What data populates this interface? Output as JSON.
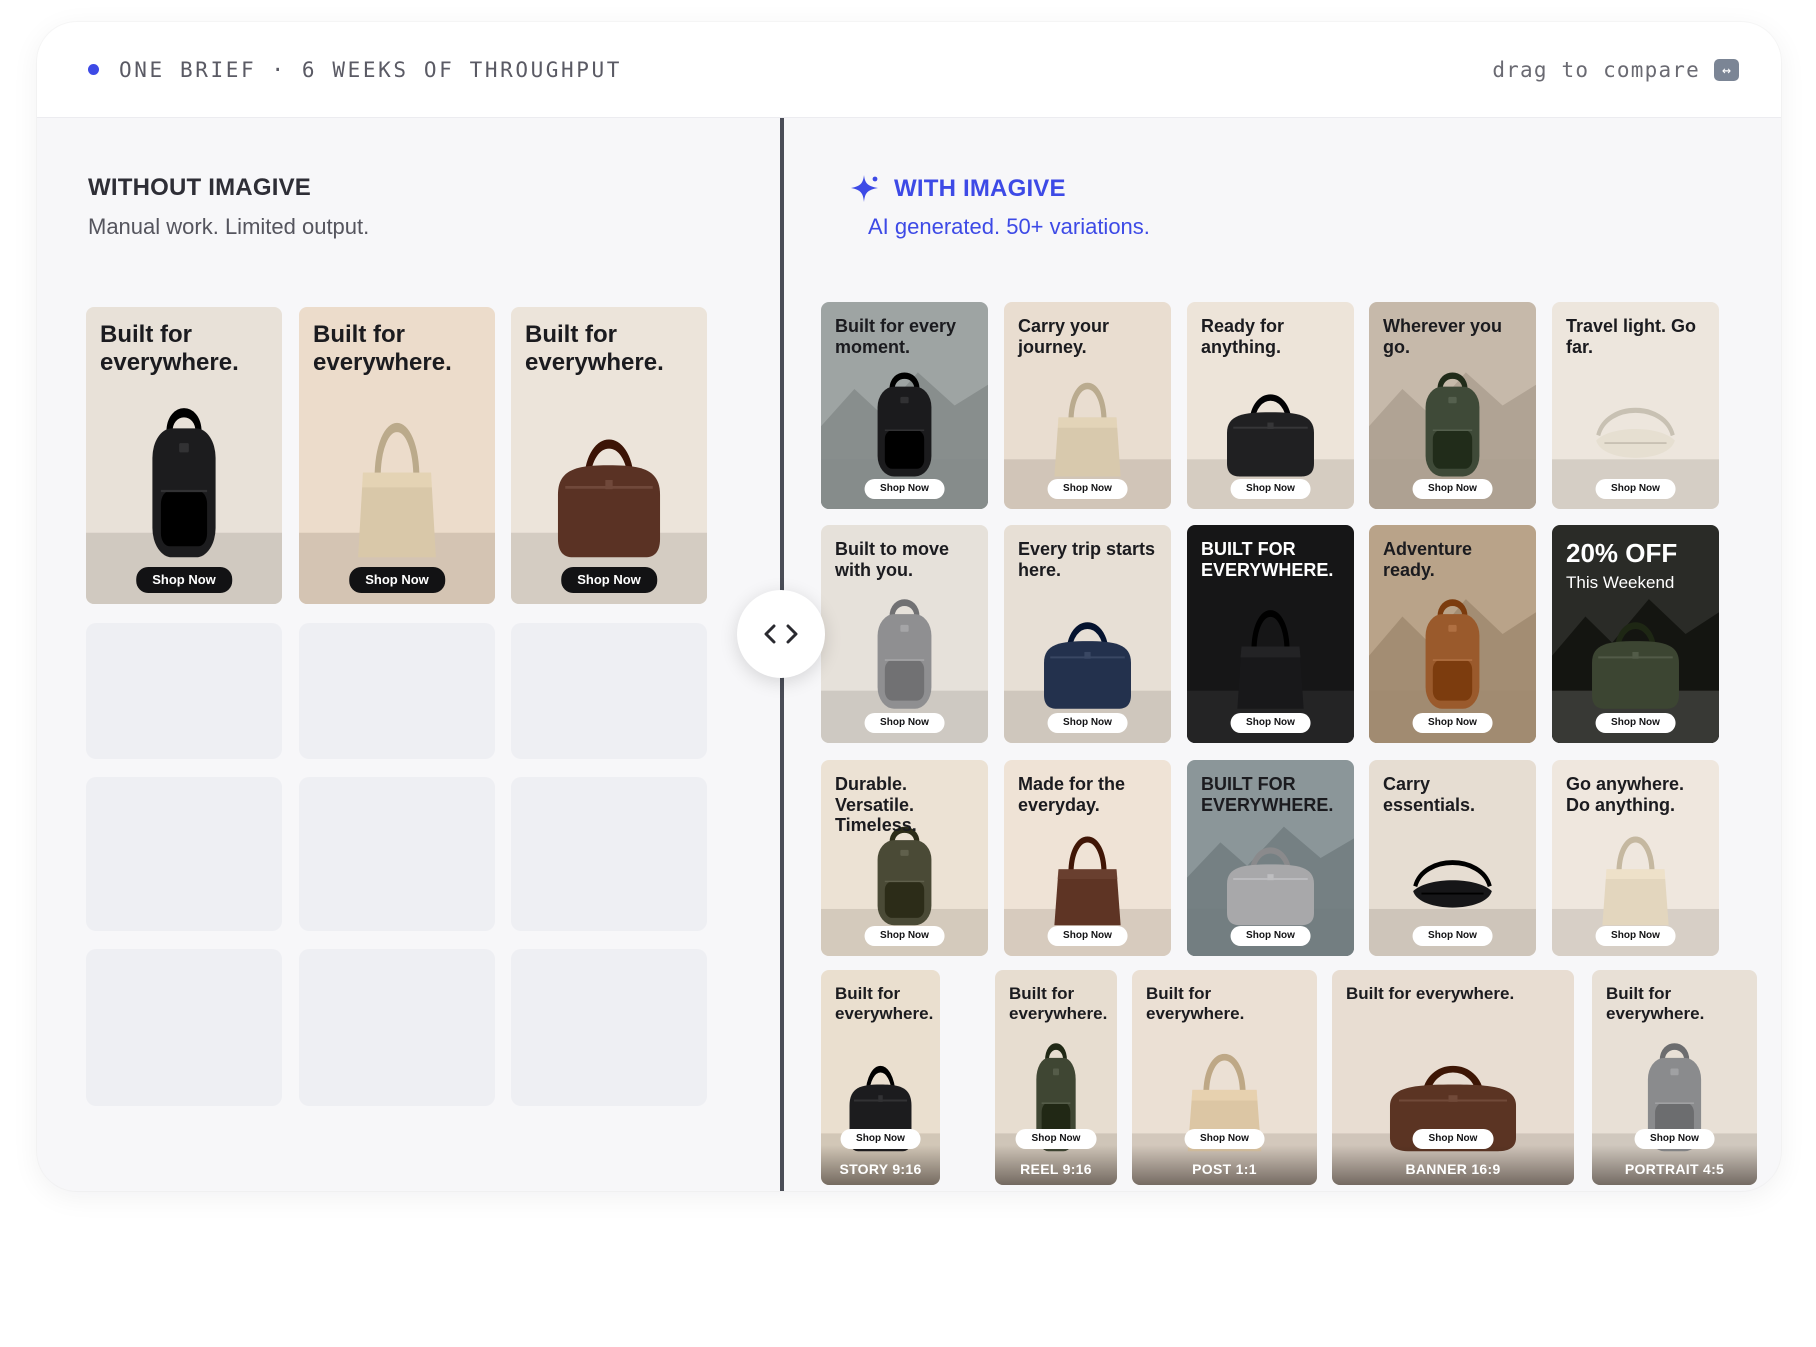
{
  "header": {
    "left_text": "ONE BRIEF · 6 WEEKS OF THROUGHPUT",
    "right_text": "drag to compare",
    "swap_glyph": "↔"
  },
  "left": {
    "title": "WITHOUT IMAGIVE",
    "subtitle": "Manual work. Limited output.",
    "tiles": [
      {
        "head": "Built for everywhere.",
        "cta": "Shop Now",
        "bag": "backpack",
        "bag_color": "#1c1c1e",
        "bg": "#e8e1d8"
      },
      {
        "head": "Built for everywhere.",
        "cta": "Shop Now",
        "bag": "tote",
        "bag_color": "#d9c8a9",
        "bg": "#ecdccb"
      },
      {
        "head": "Built for everywhere.",
        "cta": "Shop Now",
        "bag": "duffel",
        "bag_color": "#5a3224",
        "bg": "#ece4da"
      }
    ]
  },
  "right": {
    "title": "WITH IMAGIVE",
    "subtitle": "AI generated. 50+ variations.",
    "accent": "#3d4ae6",
    "grid": [
      {
        "head": "Built for every moment.",
        "cta": "Shop Now",
        "bag": "backpack",
        "bag_color": "#1b1b1d",
        "bg": "#9ea4a3",
        "dark": false
      },
      {
        "head": "Carry your journey.",
        "cta": "Shop Now",
        "bag": "tote",
        "bag_color": "#d8c9ad",
        "bg": "#e9ddd0",
        "dark": false
      },
      {
        "head": "Ready for anything.",
        "cta": "Shop Now",
        "bag": "duffel",
        "bag_color": "#202022",
        "bg": "#ede4d9",
        "dark": false
      },
      {
        "head": "Wherever you go.",
        "cta": "Shop Now",
        "bag": "backpack",
        "bag_color": "#3f4a38",
        "bg": "#c6b9aa",
        "dark": false
      },
      {
        "head": "Travel light. Go far.",
        "cta": "Shop Now",
        "bag": "sling",
        "bag_color": "#e6dfd1",
        "bg": "#ede6dd",
        "dark": false
      },
      {
        "head": "Built to move with you.",
        "cta": "Shop Now",
        "bag": "backpack",
        "bag_color": "#8f8f91",
        "bg": "#e6e1da",
        "dark": false
      },
      {
        "head": "Every trip starts here.",
        "cta": "Shop Now",
        "bag": "duffel",
        "bag_color": "#23314d",
        "bg": "#e7dfd5",
        "dark": false
      },
      {
        "head": "BUILT FOR EVERYWHERE.",
        "cta": "Shop Now",
        "bag": "tote",
        "bag_color": "#18181a",
        "bg": "#161617",
        "dark": true
      },
      {
        "head": "Adventure ready.",
        "cta": "Shop Now",
        "bag": "backpack",
        "bag_color": "#9a5a2c",
        "bg": "#b9a389",
        "dark": false
      },
      {
        "head": "20% OFF",
        "sub": "This Weekend",
        "cta": "Shop Now",
        "bag": "duffel",
        "bag_color": "#3c4532",
        "bg": "#2a2b27",
        "dark": true
      },
      {
        "head": "Durable. Versatile. Timeless.",
        "cta": "Shop Now",
        "bag": "backpack",
        "bag_color": "#4a4a36",
        "bg": "#ece2d4",
        "dark": false
      },
      {
        "head": "Made for the everyday.",
        "cta": "Shop Now",
        "bag": "tote",
        "bag_color": "#5e3424",
        "bg": "#efe3d6",
        "dark": false
      },
      {
        "head": "BUILT FOR EVERYWHERE.",
        "cta": "Shop Now",
        "bag": "duffel",
        "bag_color": "#a8a8aa",
        "bg": "#8b9699",
        "dark": false
      },
      {
        "head": "Carry essentials.",
        "cta": "Shop Now",
        "bag": "sling",
        "bag_color": "#161618",
        "bg": "#e6ddd2",
        "dark": false
      },
      {
        "head": "Go anywhere. Do anything.",
        "cta": "Shop Now",
        "bag": "tote",
        "bag_color": "#e3d6be",
        "bg": "#efe7de",
        "dark": false
      }
    ],
    "formats": [
      {
        "head": "Built for everywhere.",
        "cta": "Shop Now",
        "label": "STORY 9:16",
        "bag": "duffel",
        "bag_color": "#1c1c1e",
        "bg": "#eadfcf"
      },
      {
        "head": "Built for everywhere.",
        "cta": "Shop Now",
        "label": "REEL 9:16",
        "bag": "backpack",
        "bag_color": "#3f4633",
        "bg": "#e7ddd0"
      },
      {
        "head": "Built for everywhere.",
        "cta": "Shop Now",
        "label": "POST 1:1",
        "bag": "tote",
        "bag_color": "#dcc6a4",
        "bg": "#ebe0d4"
      },
      {
        "head": "Built for everywhere.",
        "cta": "Shop Now",
        "label": "BANNER 16:9",
        "bag": "duffel",
        "bag_color": "#5b3423",
        "bg": "#e8ddd2"
      },
      {
        "head": "Built for everywhere.",
        "cta": "Shop Now",
        "label": "PORTRAIT 4:5",
        "bag": "backpack",
        "bag_color": "#8a8b8d",
        "bg": "#e8e0d6"
      }
    ]
  }
}
